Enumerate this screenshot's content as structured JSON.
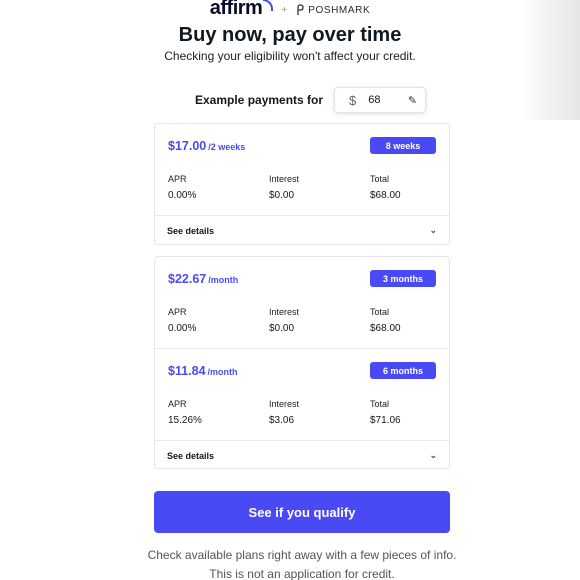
{
  "header": {
    "affirm_logo": "affirm",
    "plus": "+",
    "partner_logo": "POSHMARK"
  },
  "title": "Buy now, pay over time",
  "subtitle": "Checking your eligibility won't affect your credit.",
  "example": {
    "label": "Example payments for",
    "currency": "$",
    "amount": "68",
    "edit_icon": "pencil-icon"
  },
  "plans": [
    {
      "amount": "$17.00",
      "period": "/2 weeks",
      "badge": "8 weeks",
      "apr_label": "APR",
      "apr": "0.00%",
      "interest_label": "Interest",
      "interest": "$0.00",
      "total_label": "Total",
      "total": "$68.00"
    },
    {
      "amount": "$22.67",
      "period": "/month",
      "badge": "3 months",
      "apr_label": "APR",
      "apr": "0.00%",
      "interest_label": "Interest",
      "interest": "$0.00",
      "total_label": "Total",
      "total": "$68.00"
    },
    {
      "amount": "$11.84",
      "period": "/month",
      "badge": "6 months",
      "apr_label": "APR",
      "apr": "15.26%",
      "interest_label": "Interest",
      "interest": "$3.06",
      "total_label": "Total",
      "total": "$71.06"
    }
  ],
  "see_details": "See details",
  "cta": "See if you qualify",
  "footnote_line1": "Check available plans right away with a few pieces of info.",
  "footnote_line2": "This is not an application for credit.",
  "colors": {
    "accent": "#4a4af4",
    "text": "#101820",
    "border": "#e4e4ea"
  }
}
